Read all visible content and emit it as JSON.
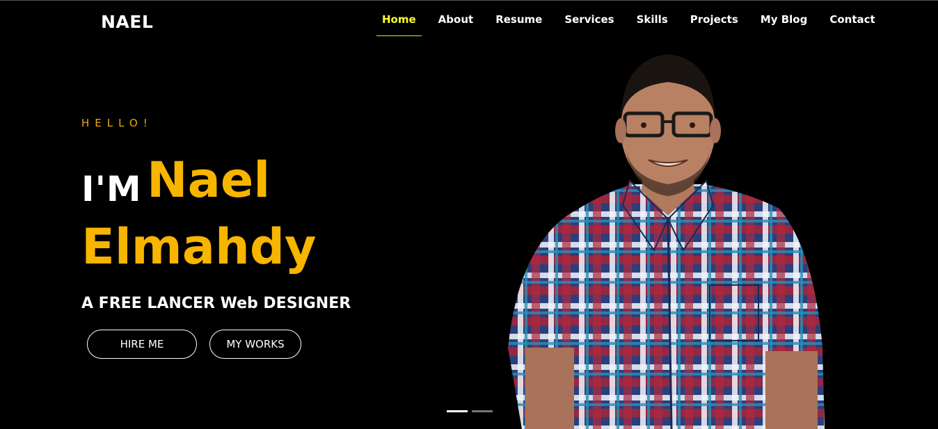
{
  "header": {
    "brand": "NAEL",
    "nav": [
      {
        "label": "Home",
        "active": true
      },
      {
        "label": "About",
        "active": false
      },
      {
        "label": "Resume",
        "active": false
      },
      {
        "label": "Services",
        "active": false
      },
      {
        "label": "Skills",
        "active": false
      },
      {
        "label": "Projects",
        "active": false
      },
      {
        "label": "My Blog",
        "active": false
      },
      {
        "label": "Contact",
        "active": false
      }
    ]
  },
  "hero": {
    "greeting": "HELLO!",
    "intro": "I'M",
    "first_name": "Nael",
    "last_name": "Elmahdy",
    "subtitle": "A FREE LANCER Web DESIGNER",
    "buttons": {
      "hire": "HIRE ME",
      "works": "MY WORKS"
    },
    "slider": {
      "slides": 2,
      "active": 1
    }
  },
  "colors": {
    "background": "#000000",
    "accent": "#f7b500",
    "nav_active": "#ffff33",
    "text": "#ffffff"
  },
  "icons": {
    "portrait": "person-photo"
  }
}
